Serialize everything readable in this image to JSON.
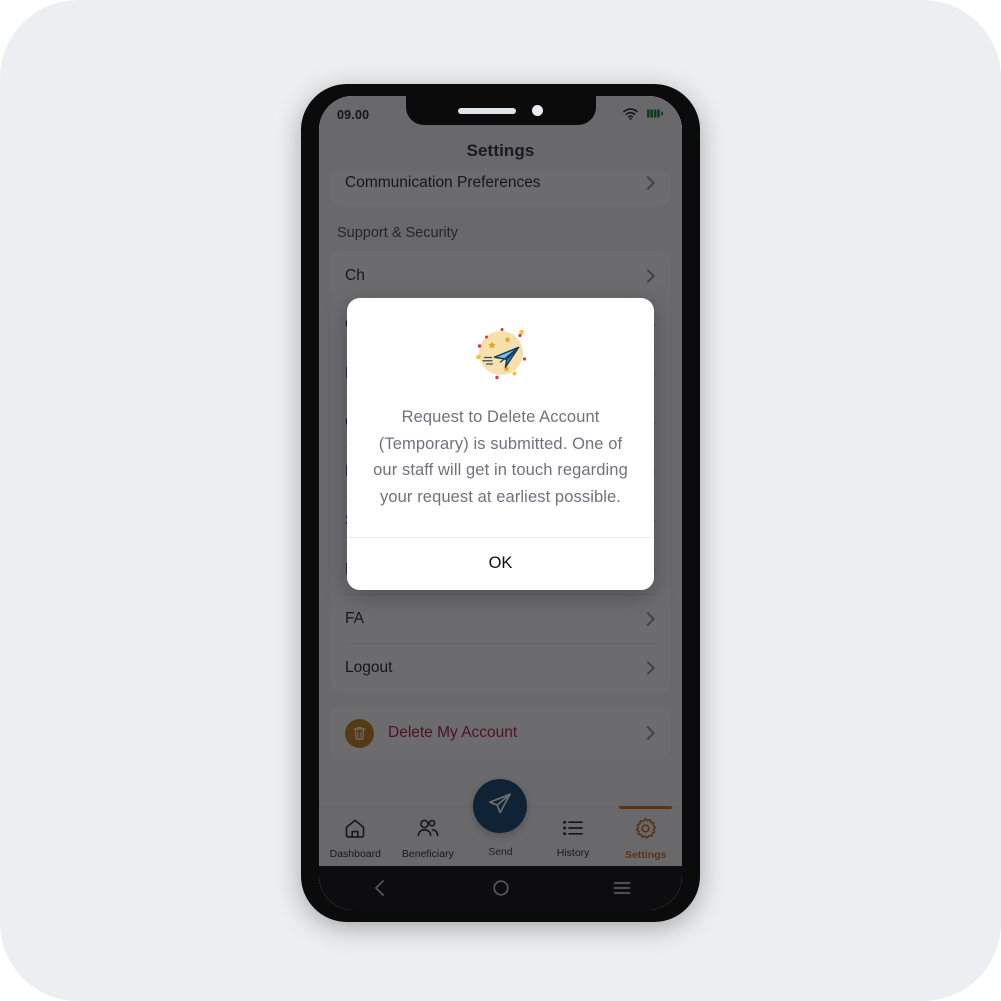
{
  "status_bar": {
    "time": "09.00",
    "wifi_icon": "wifi-icon",
    "battery_icon": "battery-icon"
  },
  "header": {
    "title": "Settings"
  },
  "settings": {
    "top_card": [
      {
        "label": "Communication Preferences",
        "chevron": "chevron-right-icon"
      }
    ],
    "section_heading": "Support & Security",
    "support_rows": [
      {
        "label": "Ch",
        "chevron": "chevron-right-icon"
      },
      {
        "label": "Ou",
        "chevron": "chevron-right-icon"
      },
      {
        "label": "KY",
        "chevron": "chevron-right-icon"
      },
      {
        "label": "Co",
        "chevron": "chevron-right-icon"
      },
      {
        "label": "No",
        "chevron": "chevron-right-icon"
      },
      {
        "label": "Se",
        "chevron": "chevron-right-icon"
      },
      {
        "label": "M",
        "chevron": "chevron-right-icon"
      },
      {
        "label": "FA",
        "chevron": "chevron-right-icon"
      },
      {
        "label": "Logout",
        "chevron": "chevron-right-icon"
      }
    ],
    "delete_row": {
      "label": "Delete My Account",
      "icon": "trash-icon",
      "chevron": "chevron-right-icon",
      "label_color": "#b4103c",
      "icon_bg": "#c07a16"
    }
  },
  "modal": {
    "icon": "paper-plane-badge-icon",
    "message": "Request to Delete Account (Temporary) is submitted. One of our staff will get in touch regarding your request at earliest possible.",
    "ok_label": "OK"
  },
  "tabbar": {
    "tabs": [
      {
        "label": "Dashboard",
        "icon": "home-icon",
        "active": false
      },
      {
        "label": "Beneficiary",
        "icon": "people-icon",
        "active": false
      },
      {
        "label": "Send",
        "icon": "paper-plane-icon",
        "active": false
      },
      {
        "label": "History",
        "icon": "list-icon",
        "active": false
      },
      {
        "label": "Settings",
        "icon": "gear-icon",
        "active": true
      }
    ],
    "active_color": "#cf6a16",
    "fab_color": "#0d3b69"
  },
  "android_nav": {
    "back": "back-chevron-icon",
    "home": "home-circle-icon",
    "recents": "menu-lines-icon"
  }
}
